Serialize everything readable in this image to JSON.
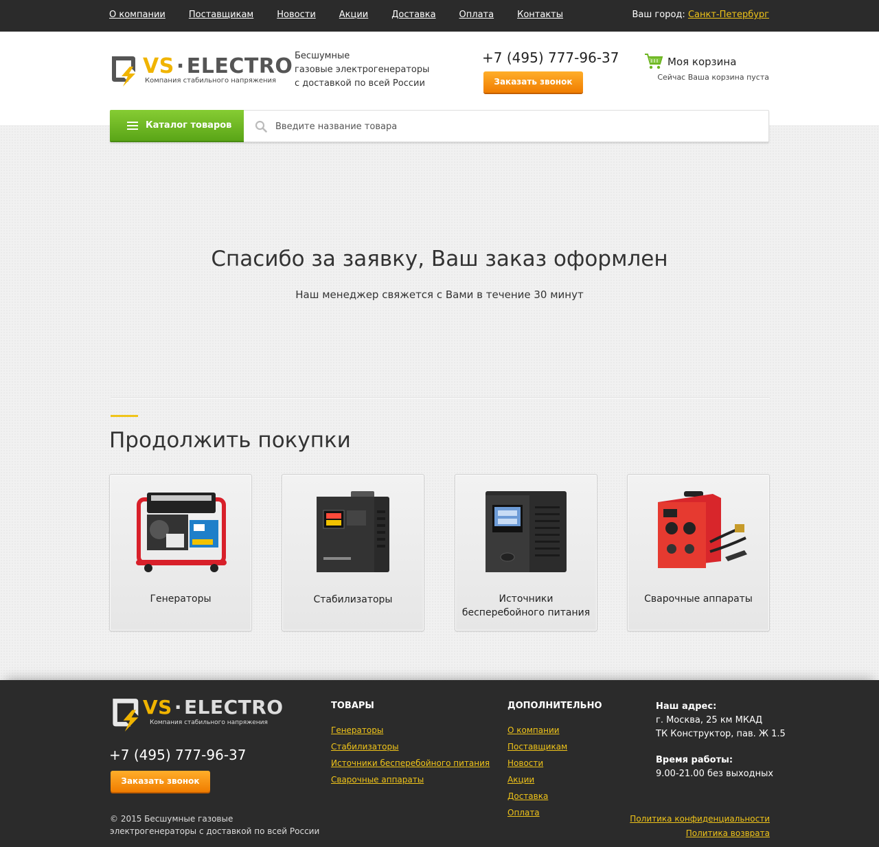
{
  "topbar": {
    "nav": [
      "О компании",
      "Поставщикам",
      "Новости",
      "Акции",
      "Доставка",
      "Оплата",
      "Контакты"
    ],
    "city_label": "Ваш город:",
    "city_value": "Санкт-Петербург"
  },
  "header": {
    "logo_vs": "VS",
    "logo_brand": "ELECTRO",
    "logo_tagline": "Компания стабильного напряжения",
    "tagline_lines": [
      "Бесшумные",
      "газовые электрогенераторы",
      "с доставкой по всей России"
    ],
    "phone": "+7 (495) 777-96-37",
    "callback_button": "Заказать звонок",
    "cart_title": "Моя корзина",
    "cart_status": "Сейчас Ваша корзина пуста"
  },
  "search": {
    "catalog_button": "Каталог товаров",
    "placeholder": "Введите название товара"
  },
  "confirmation": {
    "title": "Спасибо за заявку, Ваш заказ оформлен",
    "subtitle": "Наш менеджер свяжется с Вами в течение 30 минут"
  },
  "continue_shopping": {
    "title": "Продолжить покупки",
    "categories": [
      {
        "label_lines": [
          "Генераторы"
        ],
        "icon": "generator-icon"
      },
      {
        "label_lines": [
          "Стабилизаторы"
        ],
        "icon": "stabilizer-icon"
      },
      {
        "label_lines": [
          "Источники",
          "бесперебойного питания"
        ],
        "icon": "ups-icon"
      },
      {
        "label_lines": [
          "Сварочные аппараты"
        ],
        "icon": "welding-machine-icon"
      }
    ]
  },
  "footer": {
    "phone": "+7 (495) 777-96-37",
    "callback_button": "Заказать звонок",
    "copyright_lines": [
      "© 2015 Бесшумные газовые",
      "электрогенераторы с доставкой по всей России"
    ],
    "goods_title": "ТОВАРЫ",
    "goods_links": [
      "Генераторы",
      "Стабилизаторы",
      "Источники бесперебойного питания",
      "Сварочные аппараты"
    ],
    "extra_title": "ДОПОЛНИТЕЛЬНО",
    "extra_links": [
      "О компании",
      "Поставщикам",
      "Новости",
      "Акции",
      "Доставка",
      "Оплата"
    ],
    "address_label": "Наш адрес:",
    "address_lines": [
      "г. Москва, 25 км МКАД",
      "ТК Конструктор, пав. Ж 1.5"
    ],
    "hours_label": "Время работы:",
    "hours_value": "9.00-21.00 без выходных",
    "policies": [
      "Политика конфиденциальности",
      "Политика возврата"
    ]
  },
  "colors": {
    "accent_yellow": "#f0c419",
    "button_orange": "#f68c0c",
    "catalog_green": "#6cb420",
    "dark_bar": "#2b2b2b"
  }
}
